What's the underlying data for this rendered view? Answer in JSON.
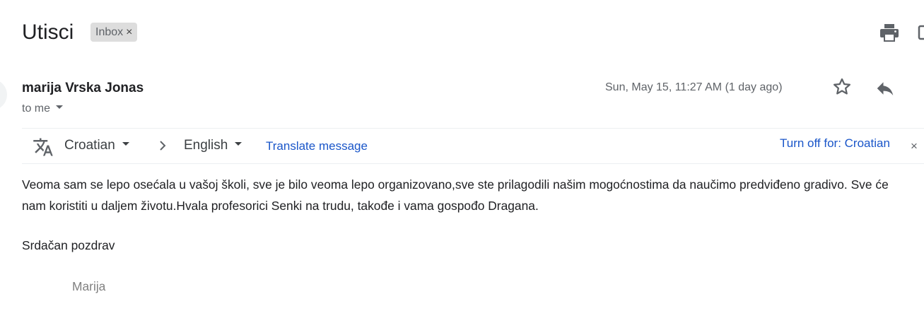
{
  "email": {
    "subject": "Utisci",
    "label": "Inbox",
    "label_remove": "×",
    "sender": "marija Vrska Jonas",
    "recipient": "to me",
    "date": "Sun, May 15, 11:27 AM (1 day ago)"
  },
  "translate_bar": {
    "source_language": "Croatian",
    "target_language": "English",
    "translate_link": "Translate message",
    "turn_off": "Turn off for: Croatian",
    "close": "×"
  },
  "message": {
    "paragraph": "Veoma sam se lepo osećala u vašoj školi, sve je bilo veoma lepo organizovano,sve ste prilagodili  našim mogoćnostima da naučimo predviđeno gradivo. Sve će nam koristiti u daljem životu.Hvala profesorici Senki na trudu, takođe i vama gospođo Dragana.",
    "closing": "Srdačan pozdrav",
    "signature": "Marija"
  },
  "icons": {
    "print": "print-icon",
    "new_window": "open-in-new-window-icon",
    "star": "star-icon",
    "reply": "reply-icon",
    "translate": "translate-icon",
    "chevron": "chevron-right-icon",
    "dropdown": "caret-down-icon"
  },
  "colors": {
    "link": "#1a56c9",
    "secondary_text": "#5f6368",
    "label_chip": "#dddddd",
    "signature": "#808080"
  }
}
